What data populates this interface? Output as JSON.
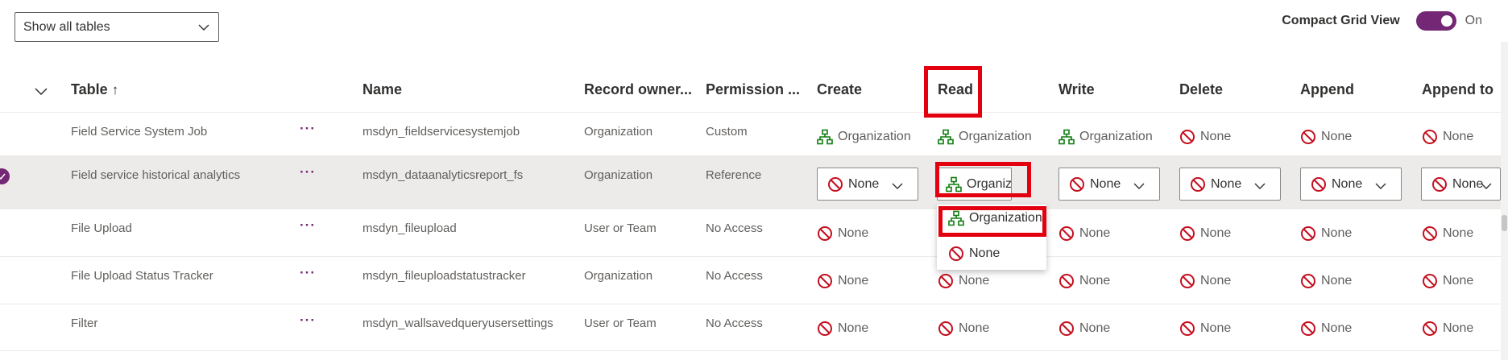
{
  "toolbar": {
    "table_filter": "Show all tables",
    "compact_label": "Compact Grid View",
    "compact_state": "On"
  },
  "columns": {
    "table": "Table",
    "table_sort": "↑",
    "name": "Name",
    "record_owner": "Record owner...",
    "permission": "Permission ...",
    "create": "Create",
    "read": "Read",
    "write": "Write",
    "delete": "Delete",
    "append": "Append",
    "append_to": "Append to"
  },
  "rows": [
    {
      "table": "Field Service System Job",
      "more": "···",
      "name": "msdyn_fieldservicesystemjob",
      "owner": "Organization",
      "permission": "Custom",
      "create": "Organization",
      "read": "Organization",
      "write": "Organization",
      "delete": "None",
      "append": "None",
      "append_to": "None"
    },
    {
      "table": "Field service historical analytics",
      "more": "···",
      "name": "msdyn_dataanalyticsreport_fs",
      "owner": "Organization",
      "permission": "Reference",
      "create": "None",
      "read": "Organization",
      "write": "None",
      "delete": "None",
      "append": "None",
      "append_to": "None"
    },
    {
      "table": "File Upload",
      "more": "···",
      "name": "msdyn_fileupload",
      "owner": "User or Team",
      "permission": "No Access",
      "create": "None",
      "read": "",
      "write": "None",
      "delete": "None",
      "append": "None",
      "append_to": "None"
    },
    {
      "table": "File Upload Status Tracker",
      "more": "···",
      "name": "msdyn_fileuploadstatustracker",
      "owner": "Organization",
      "permission": "No Access",
      "create": "None",
      "read": "None",
      "write": "None",
      "delete": "None",
      "append": "None",
      "append_to": "None"
    },
    {
      "table": "Filter",
      "more": "···",
      "name": "msdyn_wallsavedqueryusersettings",
      "owner": "User or Team",
      "permission": "No Access",
      "create": "None",
      "read": "None",
      "write": "None",
      "delete": "None",
      "append": "None",
      "append_to": "None"
    }
  ],
  "dropdown_options": [
    "Organization",
    "None"
  ],
  "icons": {
    "organization": "org-hierarchy-icon",
    "none": "prohibited-icon",
    "chevron": "chevron-down-icon",
    "selected": "check-circle-icon"
  },
  "colors": {
    "accent": "#742774",
    "org_icon": "#107c10",
    "none_icon": "#c50f1f",
    "highlight": "#e3000f",
    "selected_row": "#edebe9"
  }
}
